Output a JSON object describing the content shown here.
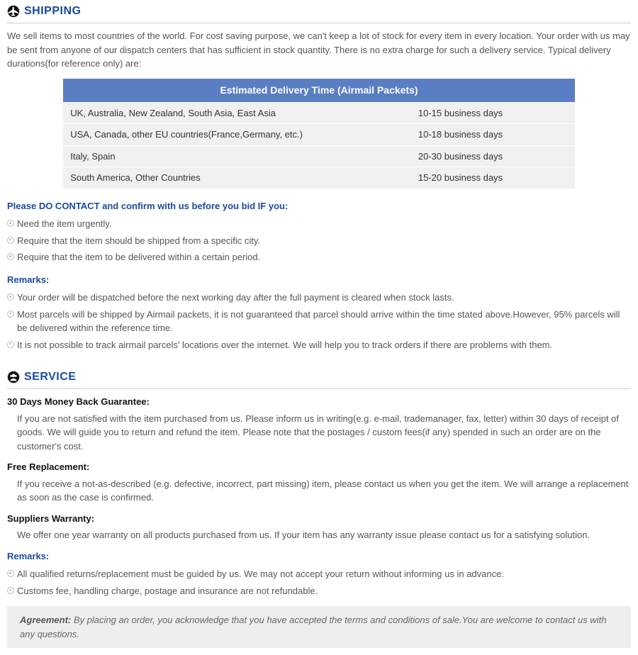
{
  "shipping": {
    "heading": "SHIPPING",
    "intro": "We sell items to most countries of the world. For cost saving purpose, we can't keep a lot of stock for every item in every location. Your order with us may be sent from anyone of our dispatch centers that has sufficient in stock quantity. There is no extra charge for such a delivery service. Typical delivery durations(for reference only) are:",
    "table": {
      "header": "Estimated Delivery Time (Airmail Packets)",
      "rows": [
        {
          "region": "UK, Australia, New Zealand, South Asia, East Asia",
          "time": "10-15 business days"
        },
        {
          "region": "USA, Canada, other EU countries(France,Germany, etc.)",
          "time": "10-18 business days"
        },
        {
          "region": "Italy, Spain",
          "time": "20-30 business days"
        },
        {
          "region": "South America, Other Countries",
          "time": "15-20 business days"
        }
      ]
    },
    "contact_heading": "Please DO CONTACT and confirm with us before you bid IF you:",
    "contact_bullets": [
      "Need the item urgently.",
      "Require that the item should be shipped from a specific city.",
      "Require that the item to be delivered within a certain period."
    ],
    "remarks_heading": "Remarks:",
    "remarks_bullets": [
      "Your order will be dispatched before the next working day after the full payment is cleared when stock lasts.",
      "Most parcels will be shipped by Airmail packets, it is not guaranteed that parcel should arrive within the time stated above.However, 95% parcels will be delivered within the reference time.",
      "It is not possible to track airmail parcels' locations over the internet. We will help you to track orders if there are problems with them."
    ]
  },
  "service": {
    "heading": "SERVICE",
    "money_back_heading": "30 Days Money Back Guarantee:",
    "money_back_text": "If you are not satisfied with the item purchased from us. Please inform us in writing(e.g. e-mail, trademanager, fax, letter) within 30 days of receipt of goods. We will guide you to return and refund the item. Please note that the postages / custom fees(if any) spended in such an order are on the customer's cost.",
    "replacement_heading": "Free Replacement:",
    "replacement_text": "If you receive a not-as-described (e.g. defective, incorrect, part missing) item, please contact us when you get the item. We will arrange a replacement as soon as the case is confirmed.",
    "warranty_heading": "Suppliers Warranty:",
    "warranty_text": "We offer one year warranty on all products purchased from us. If your item has any warranty issue please contact us for a satisfying solution.",
    "remarks_heading": "Remarks:",
    "remarks_bullets": [
      "All qualified returns/replacement must be guided by us. We may not accept your return without informing us in advance.",
      "Customs fee, handling charge, postage and insurance are not refundable."
    ]
  },
  "agreement": {
    "label": "Agreement:",
    "text": " By placing an order, you acknowledge that you have accepted the terms and conditions of sale.You are welcome to contact us with any questions."
  }
}
